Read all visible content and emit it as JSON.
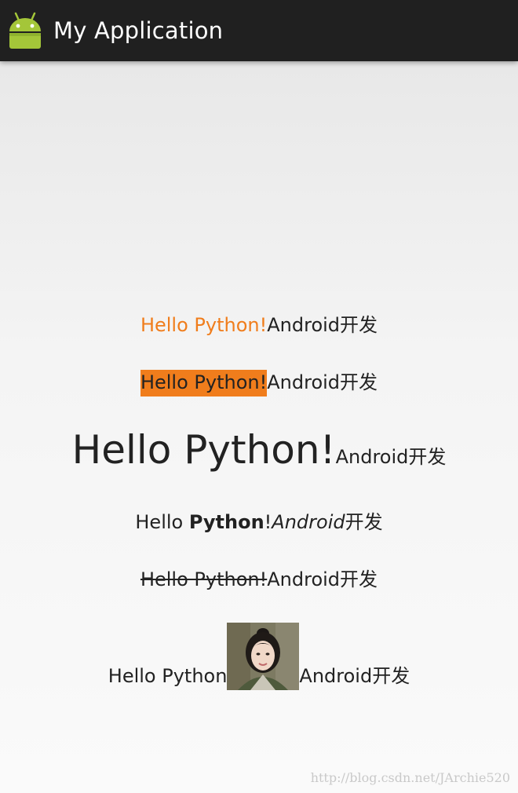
{
  "app": {
    "title": "My Application",
    "icon": "android-robot-icon",
    "icon_color": "#a4c639"
  },
  "colors": {
    "action_bar": "#202020",
    "highlight": "#f07d1c",
    "text": "#222222"
  },
  "lines": [
    {
      "part1": "Hello Python!",
      "part2": "Android开发"
    },
    {
      "part1": "Hello Python!",
      "part2": "Android开发"
    },
    {
      "part1": "Hello Python!",
      "part2": "Android开发"
    },
    {
      "part1": "Hello ",
      "part2": "Python",
      "part3": "!",
      "part4": "Android",
      "part5": "开发"
    },
    {
      "part1": "Hello Python!",
      "part2": "Android开发"
    },
    {
      "part1": "Hello Python",
      "image": "portrait-photo",
      "part2": "Android开发"
    }
  ],
  "watermark": "http://blog.csdn.net/JArchie520"
}
